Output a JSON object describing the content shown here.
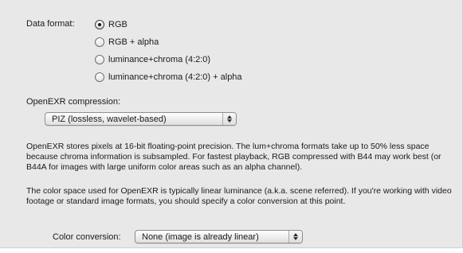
{
  "data_format": {
    "label": "Data format:",
    "options": [
      {
        "label": "RGB",
        "selected": true
      },
      {
        "label": "RGB + alpha",
        "selected": false
      },
      {
        "label": "luminance+chroma (4:2:0)",
        "selected": false
      },
      {
        "label": "luminance+chroma (4:2:0) + alpha",
        "selected": false
      }
    ]
  },
  "compression": {
    "label": "OpenEXR compression:",
    "selected": "PIZ (lossless, wavelet-based)"
  },
  "paragraphs": [
    "OpenEXR stores pixels at 16-bit floating-point precision. The lum+chroma formats take up to 50% less space because chroma information is subsampled. For fastest playback, RGB compressed with B44 may work best (or B44A for images with large uniform color areas such as an alpha channel).",
    "The color space used for OpenEXR is typically linear luminance (a.k.a. scene referred). If you're working with video footage or standard image formats, you should specify a color conversion at this point."
  ],
  "color_conversion": {
    "label": "Color conversion:",
    "selected": "None (image is already linear)"
  },
  "icons": {
    "popup_arrows": "up-down-chevron-icon"
  }
}
